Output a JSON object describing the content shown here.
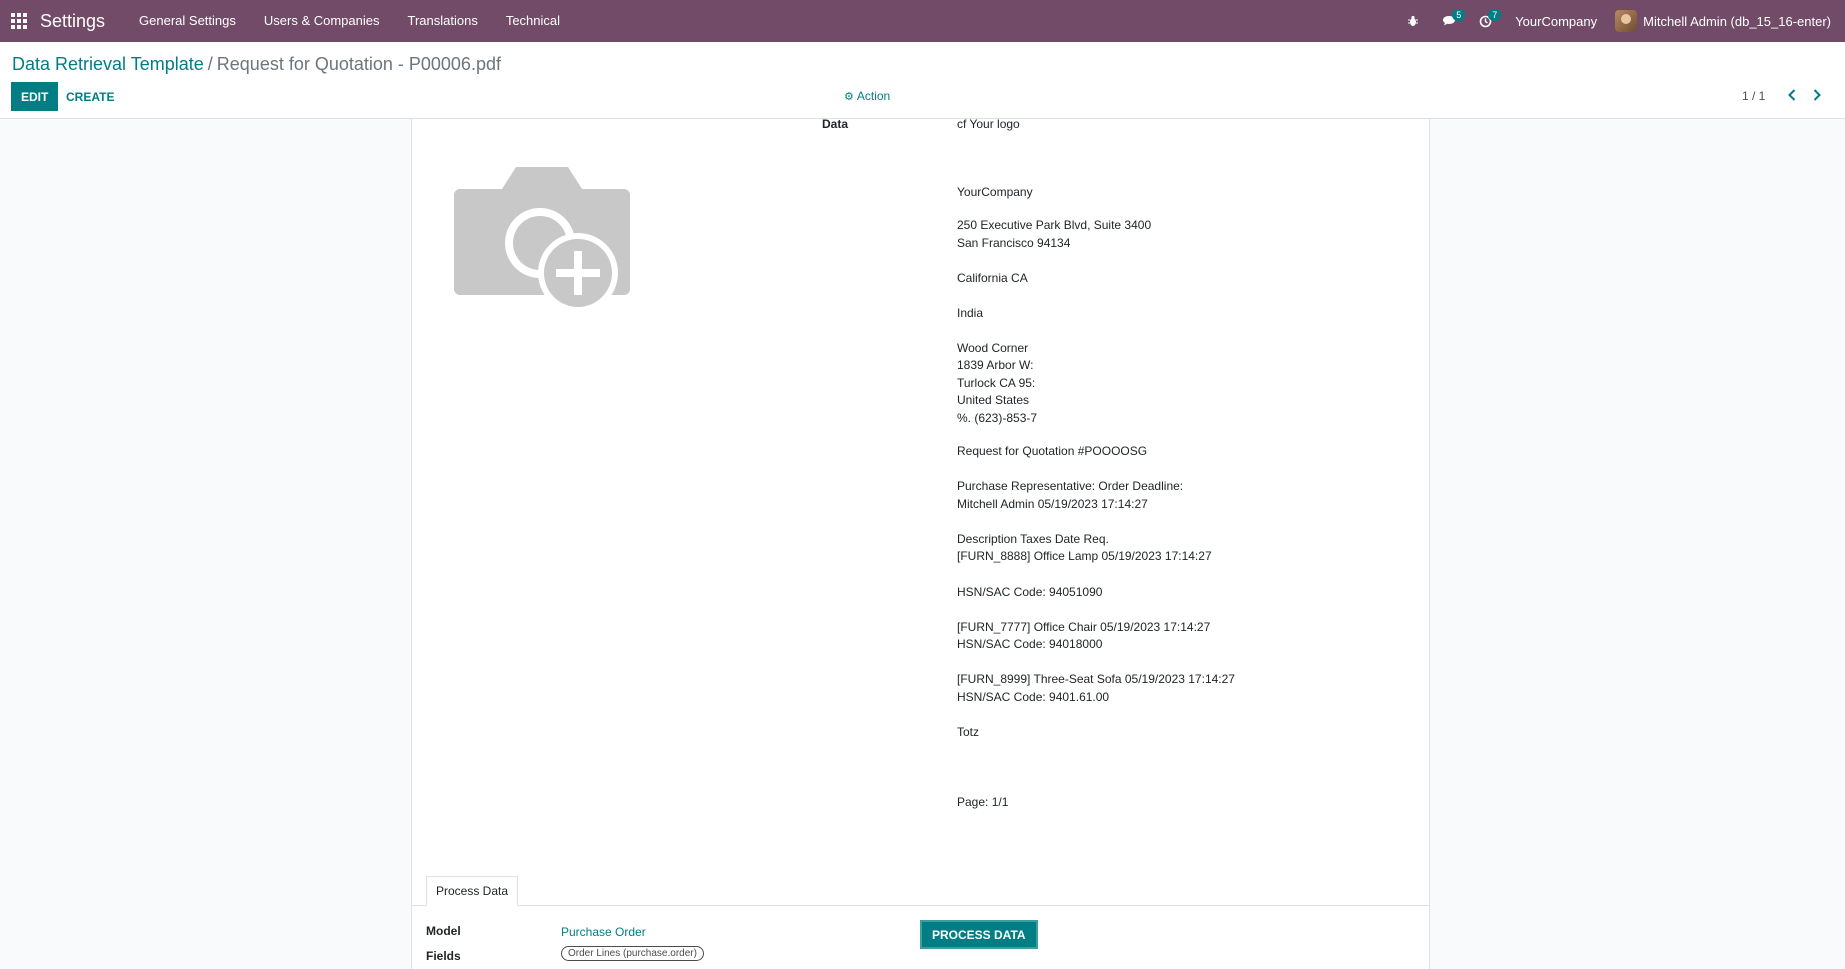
{
  "navbar": {
    "app_title": "Settings",
    "menu": [
      "General Settings",
      "Users & Companies",
      "Translations",
      "Technical"
    ],
    "messages_count": "5",
    "activities_count": "7",
    "company": "YourCompany",
    "user": "Mitchell Admin (db_15_16-enter)",
    "color": "#714b67"
  },
  "control_panel": {
    "breadcrumb_parent": "Data Retrieval Template",
    "breadcrumb_sep": "/",
    "breadcrumb_current": "Request for Quotation - P00006.pdf",
    "edit_label": "EDIT",
    "create_label": "CREATE",
    "action_label": "Action",
    "pager": "1 / 1"
  },
  "sheet": {
    "data_label": "Data",
    "logo_text": "cf Your logo",
    "lines": [
      "YourCompany",
      "250 Executive Park Blvd, Suite 3400",
      "San Francisco 94134",
      "California CA",
      "India",
      "Wood Corner",
      "1839 Arbor W:",
      "Turlock CA 95:",
      "United States",
      "%. (623)-853-7",
      "Request for Quotation #POOOOSG",
      "Purchase Representative: Order Deadline:",
      "Mitchell Admin 05/19/2023 17:14:27",
      "Description Taxes Date Req.",
      "[FURN_8888] Office Lamp 05/19/2023 17:14:27",
      "HSN/SAC Code: 94051090",
      "[FURN_7777] Office Chair 05/19/2023 17:14:27",
      "HSN/SAC Code: 94018000",
      "[FURN_8999] Three-Seat Sofa 05/19/2023 17:14:27",
      "HSN/SAC Code: 9401.61.00",
      "Totz",
      "Page: 1/1"
    ],
    "tab_label": "Process Data",
    "model_label": "Model",
    "model_value": "Purchase Order",
    "fields_label": "Fields",
    "fields_tag": "Order Lines (purchase.order)",
    "process_button": "PROCESS DATA"
  },
  "colors": {
    "primary": "#017e84",
    "navbar": "#714b67"
  }
}
